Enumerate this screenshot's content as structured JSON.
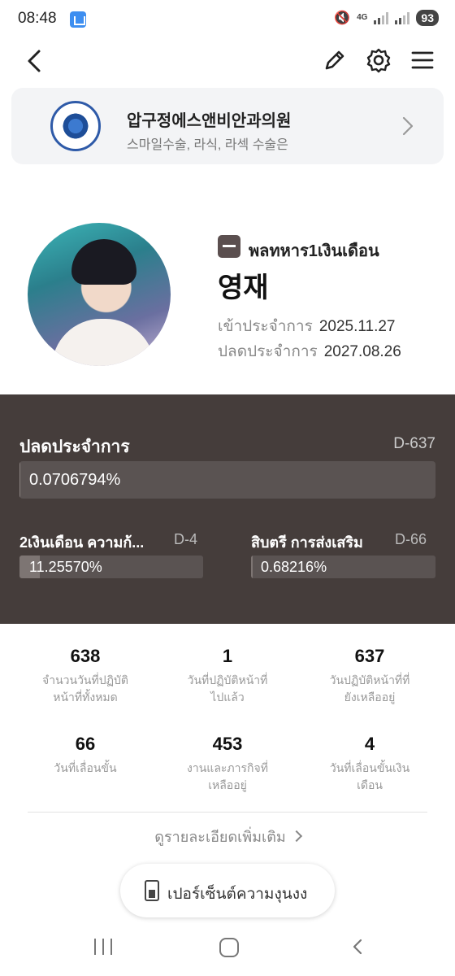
{
  "status_bar": {
    "time": "08:48",
    "network": "4G",
    "battery": "93"
  },
  "ad": {
    "title": "압구정에스앤비안과의원",
    "subtitle": "스마일수술, 라식, 라섹 수술은"
  },
  "profile": {
    "rank": "พลทหาร1เงินเดือน",
    "name": "영재",
    "enlist_label": "เข้าประจำการ",
    "enlist_date": "2025.11.27",
    "discharge_label": "ปลดประจำการ",
    "discharge_date": "2027.08.26"
  },
  "progress": {
    "main": {
      "label": "ปลดประจำการ",
      "dday": "D-637",
      "value_text": "0.0706794%",
      "fraction": 0.000707
    },
    "salary": {
      "label": "2เงินเดือน ความก้...",
      "dday": "D-4",
      "value_text": "11.25570%",
      "fraction": 0.1126
    },
    "promotion": {
      "label": "สิบตรี การส่งเสริม",
      "dday": "D-66",
      "value_text": "0.68216%",
      "fraction": 0.0068
    }
  },
  "stats": [
    {
      "value": "638",
      "label": "จำนวนวันที่ปฏิบัติ\nหน้าที่ทั้งหมด"
    },
    {
      "value": "1",
      "label": "วันที่ปฏิบัติหน้าที่\nไปแล้ว"
    },
    {
      "value": "637",
      "label": "วันปฏิบัติหน้าที่ที่\nยังเหลืออยู่"
    },
    {
      "value": "66",
      "label": "วันที่เลื่อนขั้น"
    },
    {
      "value": "453",
      "label": "งานและภารกิจที่\nเหลืออยู่"
    },
    {
      "value": "4",
      "label": "วันที่เลื่อนขั้นเงิน\nเดือน"
    }
  ],
  "more_link": "ดูรายละเอียดเพิ่มเติม",
  "pill_button": "เปอร์เซ็นต์ความงุนงง",
  "icons": {
    "back": "back-arrow-icon",
    "edit": "pencil-icon",
    "settings": "gear-icon",
    "menu": "hamburger-menu-icon"
  }
}
